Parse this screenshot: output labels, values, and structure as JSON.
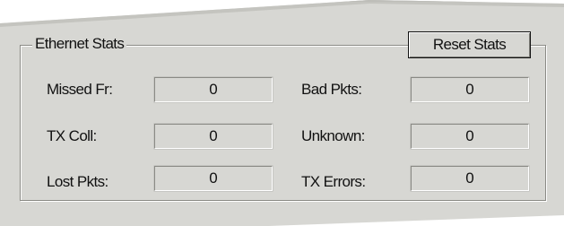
{
  "group": {
    "title": "Ethernet Stats",
    "reset_label": "Reset Stats"
  },
  "stats": {
    "missed_fr": {
      "label": "Missed Fr:",
      "value": "0"
    },
    "tx_coll": {
      "label": "TX Coll:",
      "value": "0"
    },
    "lost_pkts": {
      "label": "Lost Pkts:",
      "value": "0"
    },
    "bad_pkts": {
      "label": "Bad Pkts:",
      "value": "0"
    },
    "unknown": {
      "label": "Unknown:",
      "value": "0"
    },
    "tx_errors": {
      "label": "TX Errors:",
      "value": "0"
    }
  }
}
